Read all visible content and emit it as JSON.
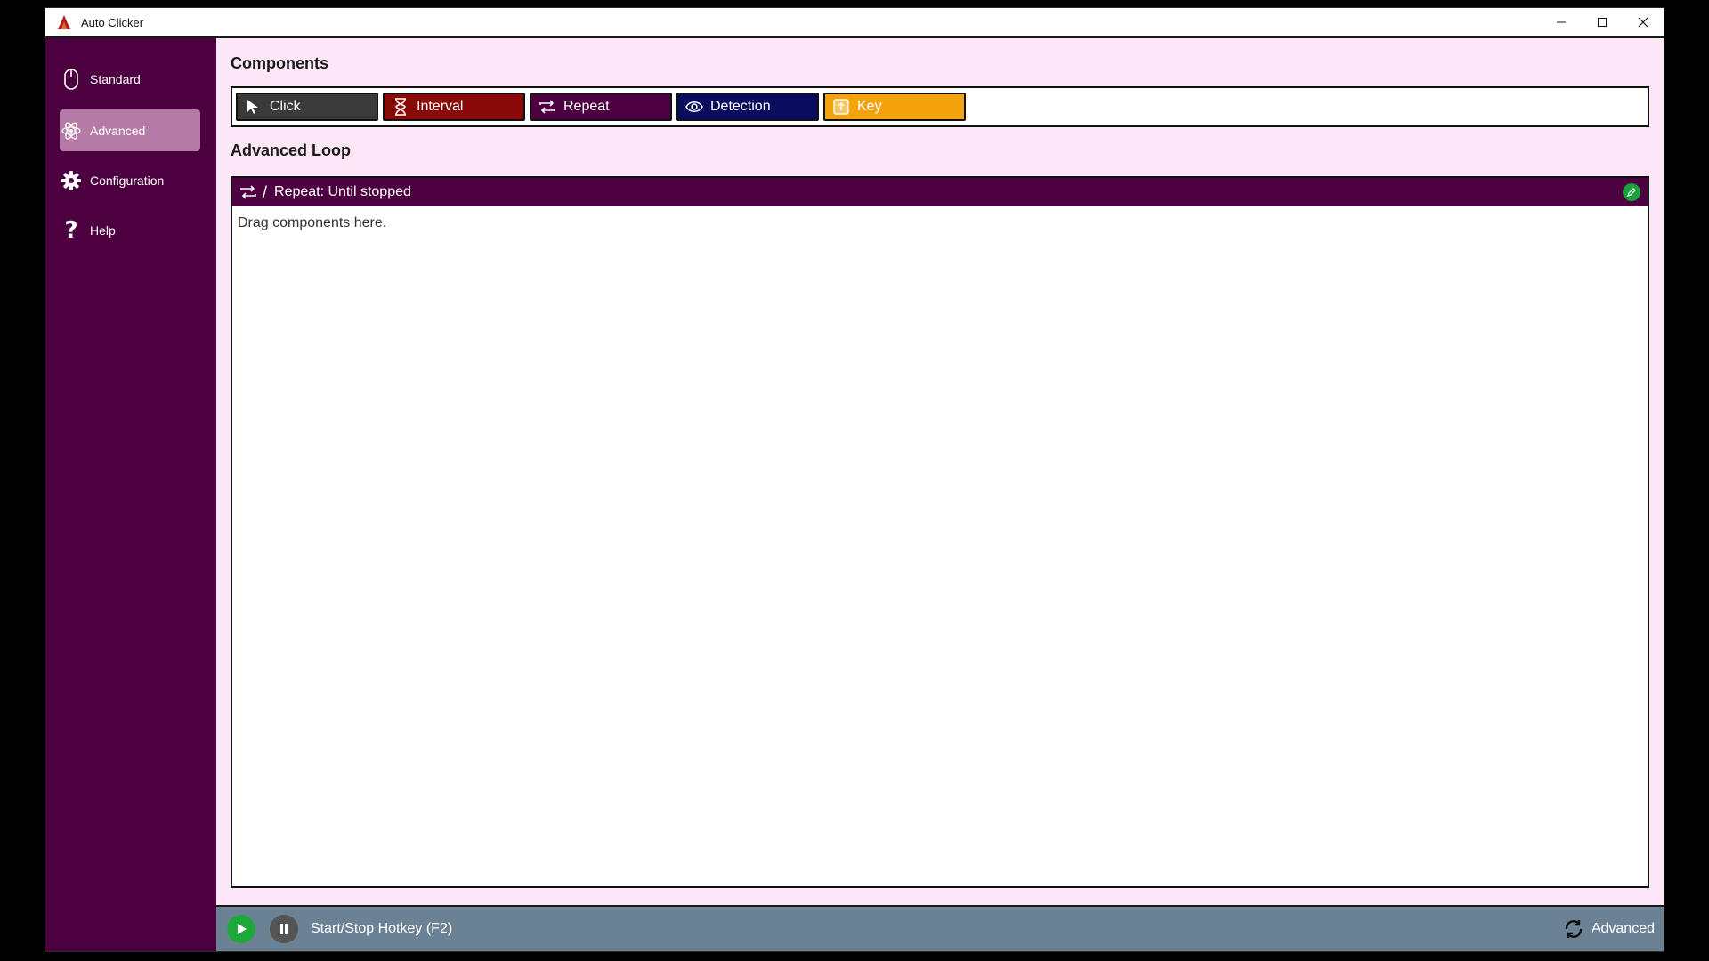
{
  "window": {
    "title": "Auto Clicker"
  },
  "sidebar": {
    "items": [
      {
        "label": "Standard",
        "icon": "mouse-icon",
        "active": false
      },
      {
        "label": "Advanced",
        "icon": "atom-icon",
        "active": true
      },
      {
        "label": "Configuration",
        "icon": "gear-icon",
        "active": false
      },
      {
        "label": "Help",
        "icon": "question-icon",
        "active": false
      }
    ]
  },
  "components": {
    "title": "Components",
    "buttons": [
      {
        "label": "Click",
        "icon": "cursor-icon",
        "color": "#3a3a3a"
      },
      {
        "label": "Interval",
        "icon": "hourglass-icon",
        "color": "#8a0a0a"
      },
      {
        "label": "Repeat",
        "icon": "repeat-icon",
        "color": "#4c0040"
      },
      {
        "label": "Detection",
        "icon": "eye-icon",
        "color": "#0c0c5e"
      },
      {
        "label": "Key",
        "icon": "key-icon",
        "color": "#f5a30d"
      }
    ]
  },
  "loop": {
    "title": "Advanced Loop",
    "header_label": "Repeat: Until stopped",
    "hint": "Drag components here."
  },
  "status": {
    "hotkey_text": "Start/Stop Hotkey (F2)",
    "mode_label": "Advanced"
  },
  "colors": {
    "sidebar_bg": "#4c0040",
    "main_bg": "#fde6f5",
    "active_item": "#b57ba6",
    "statusbar_bg": "#6b8294",
    "play_green": "#1ea83a",
    "pause_gray": "#555555"
  }
}
